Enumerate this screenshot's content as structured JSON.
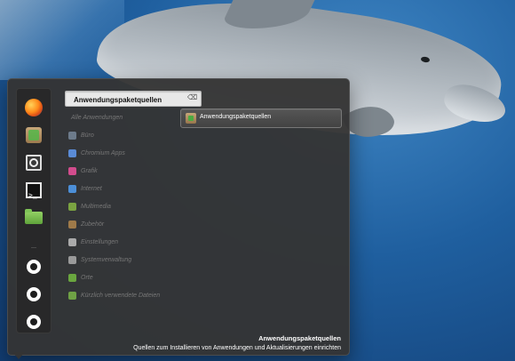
{
  "search": {
    "value": "Anwendungspaketquellen",
    "clear_symbol": "⌫"
  },
  "categories": {
    "header": "Alle Anwendungen",
    "items": [
      {
        "label": "Büro",
        "icon": "office-icon",
        "color": "#6d7b8b"
      },
      {
        "label": "Chromium Apps",
        "icon": "chromium-icon",
        "color": "#5a8bd6"
      },
      {
        "label": "Grafik",
        "icon": "graphics-icon",
        "color": "#d24c8d"
      },
      {
        "label": "Internet",
        "icon": "internet-icon",
        "color": "#4c8fd8"
      },
      {
        "label": "Multimedia",
        "icon": "multimedia-icon",
        "color": "#7aa341"
      },
      {
        "label": "Zubehör",
        "icon": "accessories-icon",
        "color": "#9f7a49"
      },
      {
        "label": "Einstellungen",
        "icon": "settings-icon",
        "color": "#aaaaaa"
      },
      {
        "label": "Systemverwaltung",
        "icon": "system-icon",
        "color": "#9a9a9a"
      },
      {
        "label": "Orte",
        "icon": "places-icon",
        "color": "#6aa63f"
      },
      {
        "label": "Kürzlich verwendete Dateien",
        "icon": "recent-files-icon",
        "color": "#6fa145"
      }
    ]
  },
  "results": [
    {
      "label": "Anwendungspaketquellen",
      "icon": "software-sources-icon"
    }
  ],
  "footer": {
    "title": "Anwendungspaketquellen",
    "description": "Quellen zum Installieren von Anwendungen und Aktualisierungen einrichten"
  }
}
